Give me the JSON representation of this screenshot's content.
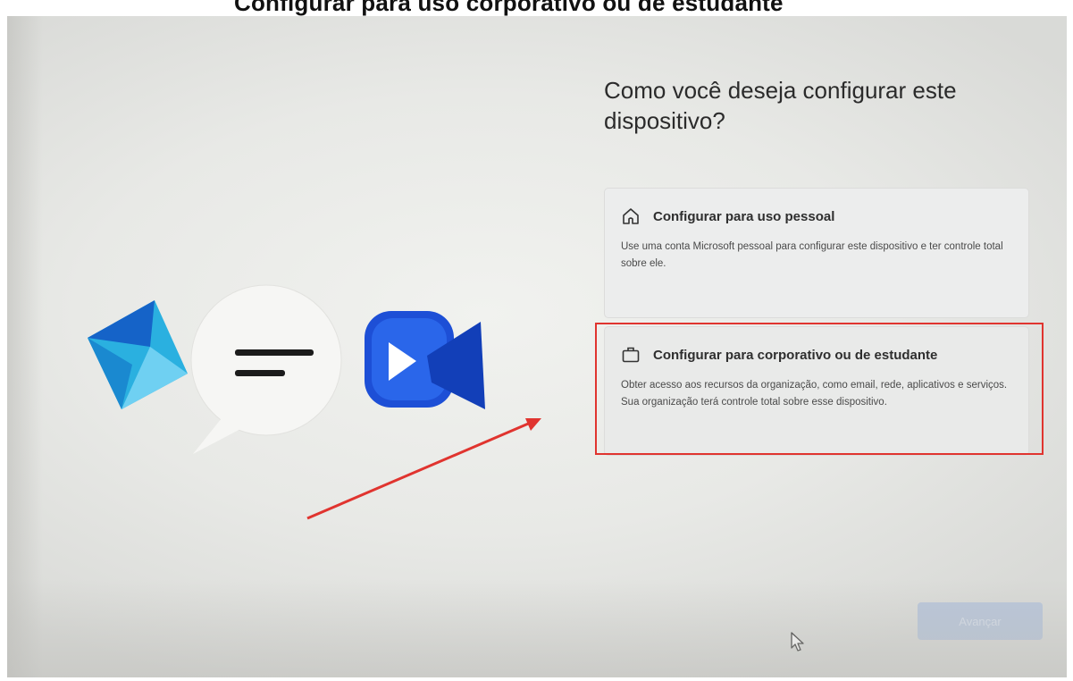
{
  "top_banner": {
    "text": "Configurar para uso corporativo ou de estudante"
  },
  "setup": {
    "title": "Como você deseja configurar este dispositivo?",
    "options": [
      {
        "icon": "home-icon",
        "title": "Configurar para uso pessoal",
        "description": "Use uma conta Microsoft pessoal para configurar este dispositivo e ter controle total sobre ele."
      },
      {
        "icon": "briefcase-icon",
        "title": "Configurar para corporativo ou de estudante",
        "description": "Obter acesso aos recursos da organização, como email, rede, aplicativos e serviços. Sua organização terá controle total sobre esse dispositivo."
      }
    ],
    "next_button": "Avançar"
  },
  "colors": {
    "highlight": "#e0342f",
    "accent_blue": "#1f5fe0",
    "disabled_button": "#b9c6da"
  }
}
